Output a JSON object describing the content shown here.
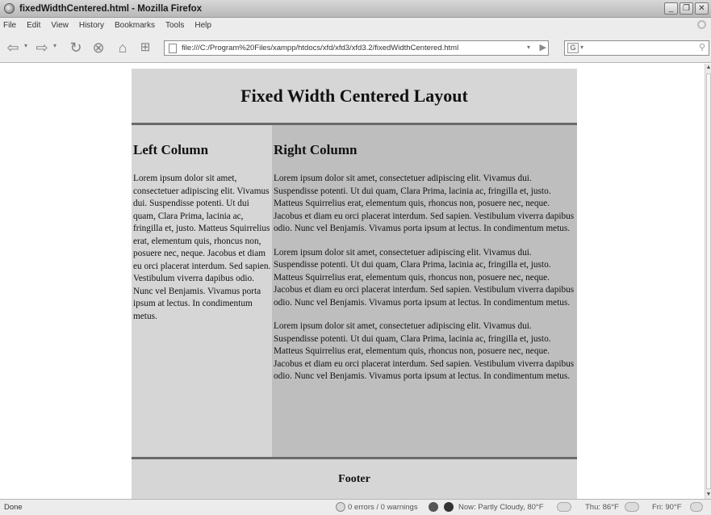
{
  "window": {
    "title": "fixedWidthCentered.html - Mozilla Firefox",
    "controls": [
      "_",
      "❐",
      "✕"
    ]
  },
  "menu": [
    "File",
    "Edit",
    "View",
    "History",
    "Bookmarks",
    "Tools",
    "Help"
  ],
  "toolbar": {
    "url": "file:///C:/Program%20Files/xampp/htdocs/xfd/xfd3/xfd3.2/fixedWidthCentered.html",
    "search_engine": "G"
  },
  "page": {
    "title": "Fixed Width Centered Layout",
    "left_heading": "Left Column",
    "right_heading": "Right Column",
    "left_text": "Lorem ipsum dolor sit amet, consectetuer adipiscing elit. Vivamus dui. Suspendisse potenti. Ut dui quam, Clara Prima, lacinia ac, fringilla et, justo. Matteus Squirrelius erat, elementum quis, rhoncus non, posuere nec, neque. Jacobus et diam eu orci placerat interdum. Sed sapien. Vestibulum viverra dapibus odio. Nunc vel Benjamis. Vivamus porta ipsum at lectus. In condimentum metus.",
    "right_paragraphs": [
      "Lorem ipsum dolor sit amet, consectetuer adipiscing elit. Vivamus dui. Suspendisse potenti. Ut dui quam, Clara Prima, lacinia ac, fringilla et, justo. Matteus Squirrelius erat, elementum quis, rhoncus non, posuere nec, neque. Jacobus et diam eu orci placerat interdum. Sed sapien. Vestibulum viverra dapibus odio. Nunc vel Benjamis. Vivamus porta ipsum at lectus. In condimentum metus.",
      "Lorem ipsum dolor sit amet, consectetuer adipiscing elit. Vivamus dui. Suspendisse potenti. Ut dui quam, Clara Prima, lacinia ac, fringilla et, justo. Matteus Squirrelius erat, elementum quis, rhoncus non, posuere nec, neque. Jacobus et diam eu orci placerat interdum. Sed sapien. Vestibulum viverra dapibus odio. Nunc vel Benjamis. Vivamus porta ipsum at lectus. In condimentum metus.",
      "Lorem ipsum dolor sit amet, consectetuer adipiscing elit. Vivamus dui. Suspendisse potenti. Ut dui quam, Clara Prima, lacinia ac, fringilla et, justo. Matteus Squirrelius erat, elementum quis, rhoncus non, posuere nec, neque. Jacobus et diam eu orci placerat interdum. Sed sapien. Vestibulum viverra dapibus odio. Nunc vel Benjamis. Vivamus porta ipsum at lectus. In condimentum metus."
    ],
    "footer": "Footer"
  },
  "status": {
    "done": "Done",
    "errors": "0 errors / 0 warnings",
    "weather_now": "Now: Partly Cloudy, 80°F",
    "forecast_thu": "Thu: 86°F",
    "forecast_fri": "Fri: 90°F"
  },
  "colors": {
    "page_light": "#d6d6d6",
    "right_column": "#bebebe",
    "rule": "#6a6a6a"
  }
}
